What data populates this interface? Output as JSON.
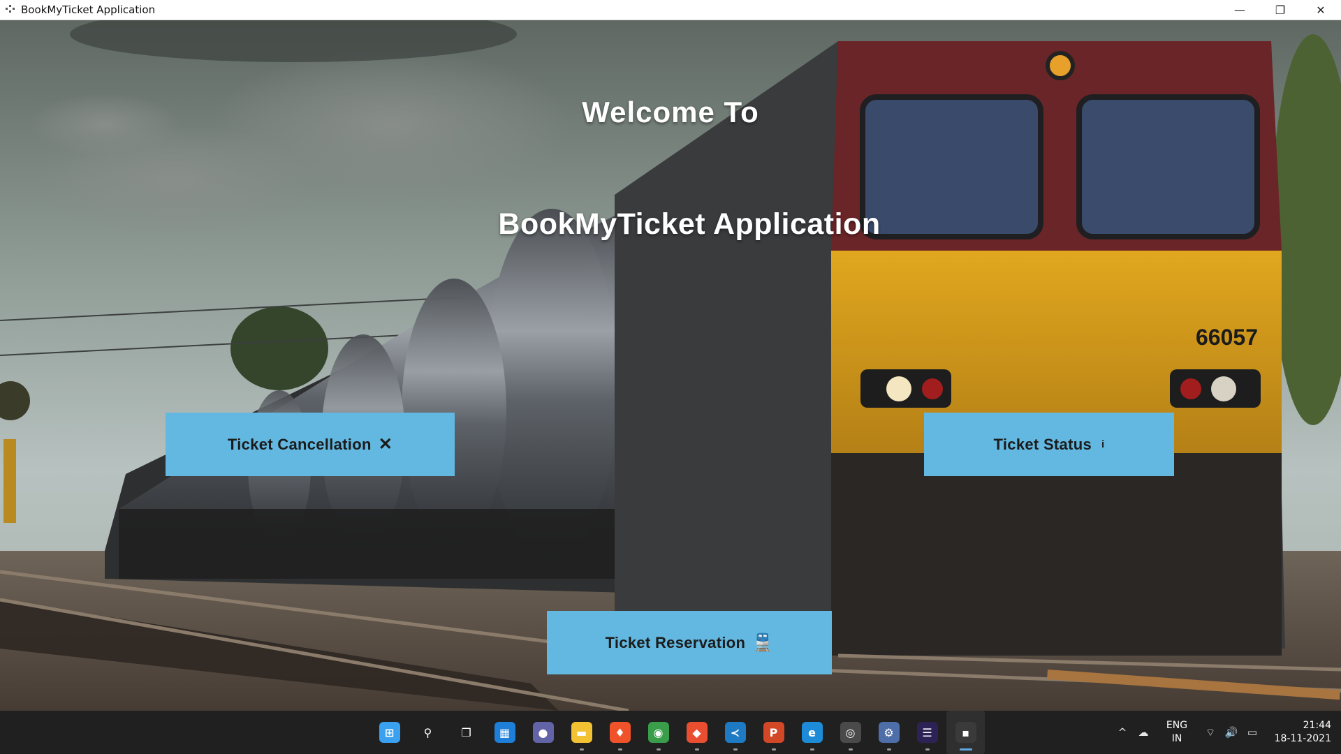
{
  "window": {
    "title": "BookMyTicket Application",
    "controls": {
      "minimize": "—",
      "maximize": "❐",
      "close": "✕"
    }
  },
  "main": {
    "welcome_text": "Welcome To",
    "app_title": "BookMyTicket Application",
    "buttons": {
      "cancellation": {
        "label": "Ticket Cancellation",
        "icon": "close-icon",
        "icon_glyph": "✕"
      },
      "status": {
        "label": "Ticket Status",
        "icon": "info-icon",
        "icon_glyph": "i"
      },
      "reservation": {
        "label": "Ticket Reservation",
        "icon": "train-icon",
        "icon_glyph": "🚆"
      }
    },
    "locomotive_number": "66057",
    "button_color": "#62b8e0"
  },
  "taskbar": {
    "apps": [
      {
        "name": "start-icon",
        "glyph": "⊞",
        "color": "#3aa0f0"
      },
      {
        "name": "search-icon",
        "glyph": "⚲",
        "color": "#202020"
      },
      {
        "name": "task-view-icon",
        "glyph": "❐",
        "color": "#202020"
      },
      {
        "name": "widgets-icon",
        "glyph": "▦",
        "color": "#1e7fd8"
      },
      {
        "name": "teams-chat-icon",
        "glyph": "●",
        "color": "#6264a7"
      },
      {
        "name": "file-explorer-icon",
        "glyph": "▬",
        "color": "#f2c233"
      },
      {
        "name": "brave-browser-icon",
        "glyph": "♦",
        "color": "#f0532a"
      },
      {
        "name": "chrome-icon",
        "glyph": "◉",
        "color": "#3a9d4a"
      },
      {
        "name": "git-icon",
        "glyph": "◆",
        "color": "#e94e31"
      },
      {
        "name": "vscode-icon",
        "glyph": "≺",
        "color": "#1f7ac4"
      },
      {
        "name": "powerpoint-icon",
        "glyph": "P",
        "color": "#d24726"
      },
      {
        "name": "edge-icon",
        "glyph": "e",
        "color": "#1d8bd8"
      },
      {
        "name": "obs-icon",
        "glyph": "◎",
        "color": "#4a4a4a"
      },
      {
        "name": "settings-icon",
        "glyph": "⚙",
        "color": "#4d6ea8"
      },
      {
        "name": "eclipse-icon",
        "glyph": "☰",
        "color": "#2c2255"
      },
      {
        "name": "java-app-icon",
        "glyph": "▪",
        "color": "#3a3a3a"
      }
    ],
    "tray": {
      "chevron": "^",
      "cloud": "☁",
      "language_top": "ENG",
      "language_bottom": "IN",
      "wifi": "⌔",
      "volume": "🔊",
      "battery": "▭",
      "time": "21:44",
      "date": "18-11-2021"
    }
  }
}
